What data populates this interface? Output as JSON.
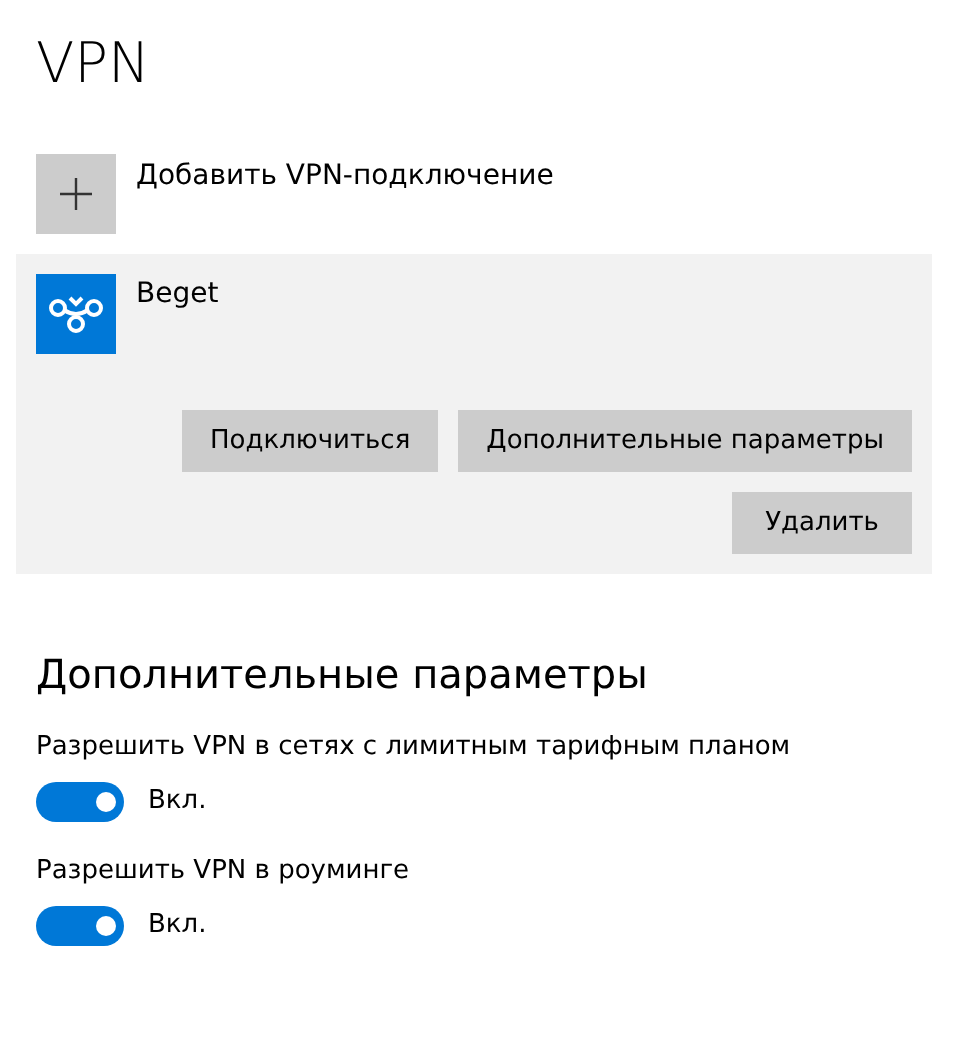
{
  "title": "VPN",
  "add_connection": {
    "label": "Добавить VPN-подключение"
  },
  "connections": [
    {
      "name": "Beget",
      "selected": true,
      "buttons": [
        "Подключиться",
        "Дополнительные параметры"
      ],
      "remove_button": "Удалить"
    }
  ],
  "advanced": {
    "heading": "Дополнительные параметры",
    "settings": [
      {
        "label": "Разрешить VPN в сетях с лимитным тарифным планом",
        "on": true,
        "state_text": "Вкл."
      },
      {
        "label": "Разрешить VPN в роуминге",
        "on": true,
        "state_text": "Вкл."
      }
    ]
  }
}
